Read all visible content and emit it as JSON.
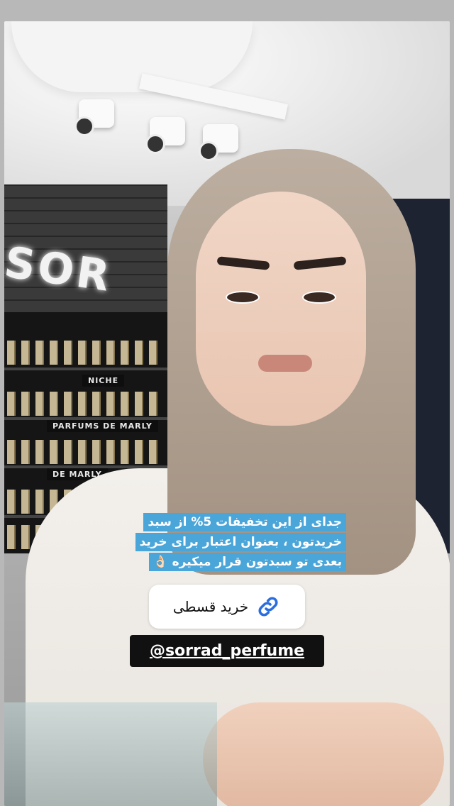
{
  "story": {
    "caption_lines": [
      "جدای از این تخفیفات 5% از سبد",
      "خریدتون ، بعنوان اعتبار برای خرید",
      "بعدی تو سبدتون قرار میکیره 👌🏻"
    ],
    "link_sticker": {
      "icon": "link-icon",
      "label": "خرید قسطی"
    },
    "mention": "@sorrad_perfume"
  },
  "colors": {
    "caption_bg": "#4aa5d9",
    "link_icon": "#2a6ee0",
    "mention_bg": "#111111"
  }
}
